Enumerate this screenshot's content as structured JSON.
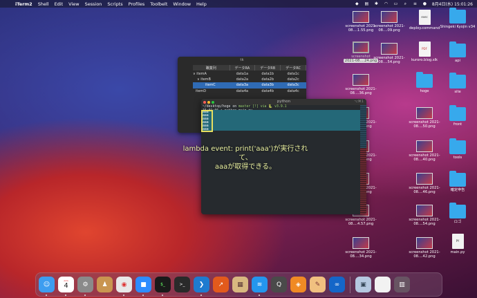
{
  "menubar": {
    "apple": "",
    "items": [
      "iTerm2",
      "Shell",
      "Edit",
      "View",
      "Session",
      "Scripts",
      "Profiles",
      "Toolbelt",
      "Window",
      "Help"
    ],
    "clock": "8月4日(水) 15:01:26",
    "status_icons": [
      "dropbox-icon",
      "tray-icon",
      "wifi-icon",
      "battery-icon",
      "search-icon",
      "control-center-icon",
      "siri-icon"
    ]
  },
  "desktop": {
    "col1": [
      {
        "label": "screenshot 2021-08....1.55.png",
        "type": "image"
      },
      {
        "label": "2021-08....24.png",
        "type": "image-selected",
        "selected": true
      },
      {
        "label": "screenshot 2021-08....36.png",
        "type": "image"
      },
      {
        "label": "screenshot 2021-08....09.png",
        "type": "image"
      },
      {
        "label": "screenshot 2021-08....40.png",
        "type": "image"
      },
      {
        "label": "screenshot 2021-08....05.png",
        "type": "image"
      },
      {
        "label": "screenshot 2021-08....4.57.png",
        "type": "image"
      },
      {
        "label": "screenshot 2021-08....34.png",
        "type": "image"
      }
    ],
    "col2": [
      {
        "label": "screenshot 2021-08....09.png",
        "type": "image"
      },
      {
        "label": "screenshot 2021-08....54.png",
        "type": "image"
      },
      {
        "label": "hoge",
        "type": "folder"
      },
      {
        "label": "screenshot 2021-08....50.png",
        "type": "image"
      },
      {
        "label": "screenshot 2021-08....40.png",
        "type": "image"
      },
      {
        "label": "screenshot 2021-08....46.png",
        "type": "image"
      },
      {
        "label": "screenshot 2021-08....54.png",
        "type": "image"
      },
      {
        "label": "screenshot 2021-08....42.png",
        "type": "image"
      }
    ],
    "col3": [
      {
        "label": "deploy.command",
        "type": "doc"
      },
      {
        "label": "kuroro.blog.slk",
        "type": "doc"
      }
    ],
    "col4": [
      {
        "label": "Shingeki Kyojin v34",
        "type": "folder"
      },
      {
        "label": "api",
        "type": "folder"
      },
      {
        "label": "site",
        "type": "folder"
      },
      {
        "label": "front",
        "type": "folder"
      },
      {
        "label": "tools",
        "type": "folder"
      },
      {
        "label": "確定申告",
        "type": "folder"
      },
      {
        "label": "ロゴ",
        "type": "folder"
      },
      {
        "label": "main.py",
        "type": "doc"
      }
    ]
  },
  "tk_window": {
    "title": "tk",
    "headers": [
      "職業列",
      "データRA",
      "データRB",
      "データRC"
    ],
    "rows": [
      {
        "tree": "∨ itemA",
        "a": "data1a",
        "b": "data1b",
        "c": "data1c",
        "indent": 0
      },
      {
        "tree": "∨ itemB",
        "a": "data2a",
        "b": "data2b",
        "c": "data2c",
        "indent": 1
      },
      {
        "tree": "itemC",
        "a": "data3a",
        "b": "data3b",
        "c": "data3c",
        "indent": 2,
        "selected": true
      },
      {
        "tree": "itemD",
        "a": "data4a",
        "b": "data4b",
        "c": "data4c",
        "indent": 0
      }
    ]
  },
  "terminal": {
    "title": "python",
    "shortcut": "⌥⌘1",
    "line1_path": "~/desktop/hoge on ",
    "line1_git": " master [!] via 🐍 v3.9.1",
    "line2": "15:01:06 ❯ python main.py",
    "output": [
      "aaa",
      "aaa",
      "aaa",
      "aaa",
      "aaa",
      "aaa"
    ]
  },
  "annotation": {
    "line1": "lambda event: print('aaa')が実行されて、",
    "line2": "aaaが取得できる。"
  },
  "dock": {
    "calendar_day": "4",
    "apps": [
      {
        "name": "finder",
        "color": "#3d9df0",
        "glyph": "☺"
      },
      {
        "name": "calendar",
        "color": "#ffffff",
        "glyph": ""
      },
      {
        "name": "system-preferences",
        "color": "#8a8a8a",
        "glyph": "⚙"
      },
      {
        "name": "contacts",
        "color": "#c99550",
        "glyph": "♟"
      },
      {
        "name": "chrome",
        "color": "#e8e8e8",
        "glyph": "◉"
      },
      {
        "name": "zoom",
        "color": "#2d8cff",
        "glyph": "■"
      },
      {
        "name": "iterm",
        "color": "#1a1a1a",
        "glyph": ">_"
      },
      {
        "name": "terminal",
        "color": "#2a2a2a",
        "glyph": ">_"
      },
      {
        "name": "vscode",
        "color": "#1e7bd0",
        "glyph": "❯"
      },
      {
        "name": "monitor",
        "color": "#e25a1c",
        "glyph": "↗"
      },
      {
        "name": "package",
        "color": "#d8b880",
        "glyph": "▦"
      },
      {
        "name": "docker",
        "color": "#2496ed",
        "glyph": "≋"
      },
      {
        "name": "quicktime",
        "color": "#4a4a4a",
        "glyph": "Q"
      },
      {
        "name": "git-tool",
        "color": "#f08a24",
        "glyph": "◈"
      },
      {
        "name": "notes",
        "color": "#f0c080",
        "glyph": "✎"
      },
      {
        "name": "infinity",
        "color": "#1466c8",
        "glyph": "∞"
      },
      {
        "name": "preview",
        "color": "#b5c8e0",
        "glyph": "▣"
      },
      {
        "name": "document",
        "color": "#f2f2f2",
        "glyph": ""
      },
      {
        "name": "trash",
        "color": "#6b6b6b",
        "glyph": "🗑"
      }
    ]
  }
}
